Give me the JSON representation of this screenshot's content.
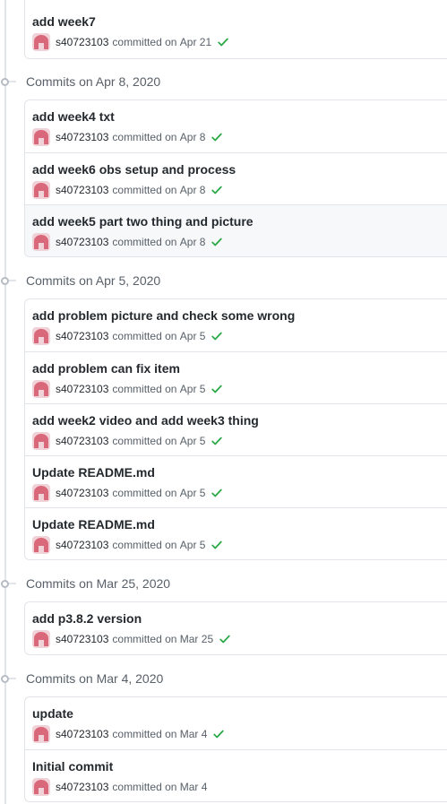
{
  "colors": {
    "status_success": "#28a745",
    "avatar": "#d9697a",
    "avatar_bg": "#f0d3d8"
  },
  "groups": [
    {
      "title": "",
      "commits": [
        {
          "message": "add week7",
          "author": "s40723103",
          "action": "committed on",
          "date": "Apr 21",
          "status_icon": "check-icon"
        }
      ]
    },
    {
      "title": "Commits on Apr 8, 2020",
      "commits": [
        {
          "message": "add week4 txt",
          "author": "s40723103",
          "action": "committed on",
          "date": "Apr 8",
          "status_icon": "check-icon"
        },
        {
          "message": "add week6 obs setup and process",
          "author": "s40723103",
          "action": "committed on",
          "date": "Apr 8",
          "status_icon": "check-icon"
        },
        {
          "message": "add week5 part two thing and picture",
          "author": "s40723103",
          "action": "committed on",
          "date": "Apr 8",
          "status_icon": "check-icon"
        }
      ]
    },
    {
      "title": "Commits on Apr 5, 2020",
      "commits": [
        {
          "message": "add problem picture and check some wrong",
          "author": "s40723103",
          "action": "committed on",
          "date": "Apr 5",
          "status_icon": "check-icon"
        },
        {
          "message": "add problem can fix item",
          "author": "s40723103",
          "action": "committed on",
          "date": "Apr 5",
          "status_icon": "check-icon"
        },
        {
          "message": "add week2 video and add week3 thing",
          "author": "s40723103",
          "action": "committed on",
          "date": "Apr 5",
          "status_icon": "check-icon"
        },
        {
          "message": "Update README.md",
          "author": "s40723103",
          "action": "committed on",
          "date": "Apr 5",
          "status_icon": "check-icon"
        },
        {
          "message": "Update README.md",
          "author": "s40723103",
          "action": "committed on",
          "date": "Apr 5",
          "status_icon": "check-icon"
        }
      ]
    },
    {
      "title": "Commits on Mar 25, 2020",
      "commits": [
        {
          "message": "add p3.8.2 version",
          "author": "s40723103",
          "action": "committed on",
          "date": "Mar 25",
          "status_icon": "check-icon"
        }
      ]
    },
    {
      "title": "Commits on Mar 4, 2020",
      "commits": [
        {
          "message": "update",
          "author": "s40723103",
          "action": "committed on",
          "date": "Mar 4",
          "status_icon": "check-icon"
        },
        {
          "message": "Initial commit",
          "author": "s40723103",
          "action": "committed on",
          "date": "Mar 4",
          "status_icon": ""
        }
      ]
    }
  ]
}
